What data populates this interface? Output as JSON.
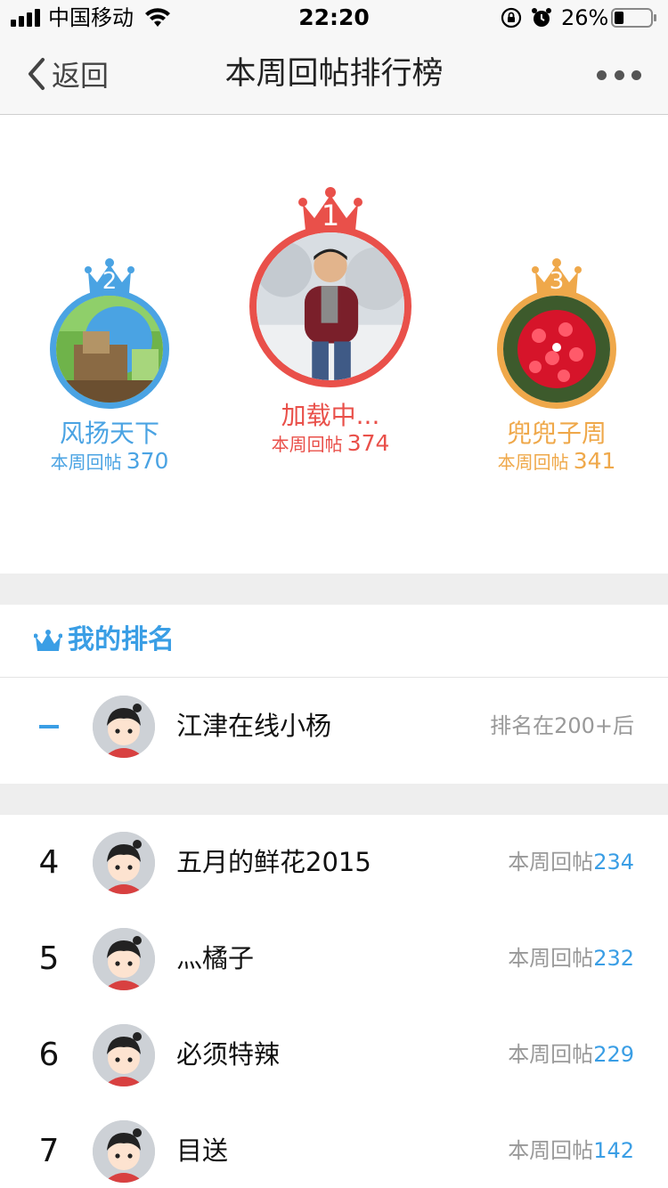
{
  "status_bar": {
    "carrier": "中国移动",
    "time": "22:20",
    "battery": "26%",
    "battery_level": 0.26
  },
  "nav": {
    "back_label": "返回",
    "title": "本周回帖排行榜"
  },
  "podium": {
    "count_label": "本周回帖",
    "first": {
      "rank": "1",
      "name": "加载中...",
      "count": "374",
      "color": "#e9504a"
    },
    "second": {
      "rank": "2",
      "name": "风扬天下",
      "count": "370",
      "color": "#4aa3e3"
    },
    "third": {
      "rank": "3",
      "name": "兜兜子周",
      "count": "341",
      "color": "#efa84a"
    }
  },
  "my_rank": {
    "title": "我的排名",
    "name": "江津在线小杨",
    "status": "排名在200+后"
  },
  "list": {
    "count_label": "本周回帖",
    "rows": [
      {
        "rank": "4",
        "name": "五月的鲜花2015",
        "count": "234"
      },
      {
        "rank": "5",
        "name": "灬橘子",
        "count": "232"
      },
      {
        "rank": "6",
        "name": "必须特辣",
        "count": "229"
      },
      {
        "rank": "7",
        "name": "目送",
        "count": "142"
      }
    ]
  },
  "colors": {
    "accent": "#3a9ee5",
    "gold": "#efa84a",
    "red": "#e9504a"
  },
  "icons": [
    "signal-icon",
    "wifi-icon",
    "rotation-lock-icon",
    "alarm-icon",
    "battery-icon",
    "back-chevron-icon",
    "more-icon",
    "crown-icon",
    "cartoon-avatar"
  ]
}
